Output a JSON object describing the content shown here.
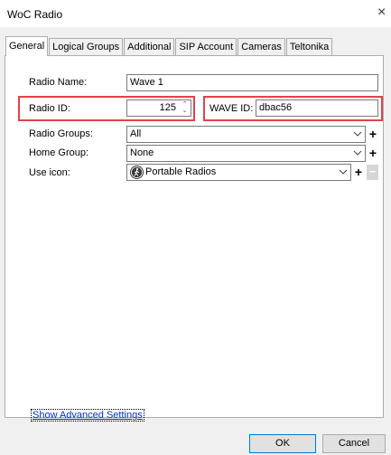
{
  "window": {
    "title": "WoC Radio",
    "close_symbol": "×"
  },
  "tabs": [
    {
      "label": "General",
      "active": true
    },
    {
      "label": "Logical Groups"
    },
    {
      "label": "Additional"
    },
    {
      "label": "SIP Account"
    },
    {
      "label": "Cameras"
    },
    {
      "label": "Teltonika"
    }
  ],
  "form": {
    "radio_name_label": "Radio Name:",
    "radio_name_value": "Wave 1",
    "radio_id_label": "Radio ID:",
    "radio_id_value": "125",
    "wave_id_label": "WAVE ID:",
    "wave_id_value": "dbac56",
    "radio_groups_label": "Radio Groups:",
    "radio_groups_value": "All",
    "home_group_label": "Home Group:",
    "home_group_value": "None",
    "use_icon_label": "Use icon:",
    "use_icon_value": "Portable Radios",
    "use_icon_icon": "walking-person-icon",
    "add_symbol": "+",
    "remove_symbol": "−",
    "spin_up": "⌃",
    "spin_down": "⌄"
  },
  "advanced_link": "Show Advanced Settings",
  "buttons": {
    "ok": "OK",
    "cancel": "Cancel"
  },
  "colors": {
    "highlight": "#e0434b",
    "link": "#0033cc",
    "default_button_border": "#0078d7"
  }
}
